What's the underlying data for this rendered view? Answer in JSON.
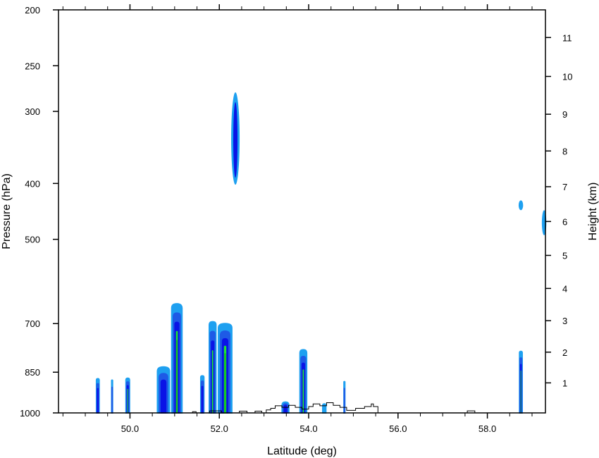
{
  "chart_data": {
    "type": "contour-cross-section",
    "xlabel": "Latitude (deg)",
    "ylabel_left": "Pressure (hPa)",
    "ylabel_right": "Height (km)",
    "xlim": [
      48.4,
      59.3
    ],
    "x_ticks": [
      50.0,
      52.0,
      54.0,
      56.0,
      58.0
    ],
    "x_tick_labels": [
      "50.0",
      "52.0",
      "54.0",
      "56.0",
      "58.0"
    ],
    "x_minor_ticks": [
      48.5,
      49.0,
      49.5,
      50.5,
      51.0,
      51.5,
      52.5,
      53.0,
      53.5,
      54.5,
      55.0,
      55.5,
      56.5,
      57.0,
      57.5,
      58.5,
      59.0
    ],
    "ylim_pressure": [
      1000,
      200
    ],
    "pressure_scale": "log",
    "pressure_ticks": [
      200,
      250,
      300,
      400,
      500,
      700,
      850,
      1000
    ],
    "pressure_tick_labels": [
      "200",
      "250",
      "300",
      "400",
      "500",
      "700",
      "850",
      "1000"
    ],
    "height_ticks": [
      1,
      2,
      3,
      4,
      5,
      6,
      7,
      8,
      9,
      10,
      11
    ],
    "height_tick_labels": [
      "1",
      "2",
      "3",
      "4",
      "5",
      "6",
      "7",
      "8",
      "9",
      "10",
      "11"
    ],
    "colors": {
      "level1": "#1ea0f0",
      "level2": "#1e5ae6",
      "level3": "#0a14e6",
      "level4": "#1ee632",
      "level5": "#14c81e",
      "terrain": "#000000"
    },
    "cells": [
      {
        "lat": 49.28,
        "width": 0.09,
        "top": 870,
        "levels": 3
      },
      {
        "lat": 49.6,
        "width": 0.05,
        "top": 875,
        "levels": 2
      },
      {
        "lat": 49.95,
        "width": 0.11,
        "top": 868,
        "levels": 4
      },
      {
        "lat": 50.75,
        "width": 0.3,
        "top": 830,
        "levels": 3
      },
      {
        "lat": 51.05,
        "width": 0.26,
        "top": 645,
        "levels": 5
      },
      {
        "lat": 51.62,
        "width": 0.1,
        "top": 860,
        "levels": 3
      },
      {
        "lat": 51.85,
        "width": 0.18,
        "top": 693,
        "levels": 4
      },
      {
        "lat": 52.13,
        "width": 0.33,
        "top": 698,
        "levels": 5
      },
      {
        "lat": 53.48,
        "width": 0.18,
        "top": 955,
        "levels": 3
      },
      {
        "lat": 53.88,
        "width": 0.18,
        "top": 775,
        "levels": 4
      },
      {
        "lat": 54.35,
        "width": 0.1,
        "top": 962,
        "levels": 1
      },
      {
        "lat": 54.8,
        "width": 0.05,
        "top": 880,
        "levels": 2
      },
      {
        "lat": 58.75,
        "width": 0.09,
        "top": 780,
        "levels": 4
      }
    ],
    "upper_features": [
      {
        "lat": 52.36,
        "p_top": 278,
        "p_bottom": 402,
        "levels": 2
      },
      {
        "lat": 58.75,
        "p_top": 428,
        "p_bottom": 445,
        "levels": 1
      },
      {
        "lat": 59.27,
        "p_top": 445,
        "p_bottom": 492,
        "levels": 1
      }
    ],
    "terrain": [
      [
        48.4,
        1000
      ],
      [
        51.4,
        1000
      ],
      [
        51.4,
        995
      ],
      [
        51.48,
        995
      ],
      [
        51.48,
        1000
      ],
      [
        51.78,
        1000
      ],
      [
        51.78,
        992
      ],
      [
        52.05,
        992
      ],
      [
        52.05,
        1000
      ],
      [
        52.45,
        1000
      ],
      [
        52.45,
        993
      ],
      [
        52.62,
        993
      ],
      [
        52.62,
        1000
      ],
      [
        52.8,
        1000
      ],
      [
        52.8,
        993
      ],
      [
        52.95,
        993
      ],
      [
        52.95,
        1000
      ],
      [
        53.05,
        1000
      ],
      [
        53.05,
        988
      ],
      [
        53.15,
        988
      ],
      [
        53.15,
        982
      ],
      [
        53.25,
        982
      ],
      [
        53.25,
        972
      ],
      [
        53.4,
        972
      ],
      [
        53.4,
        978
      ],
      [
        53.55,
        978
      ],
      [
        53.55,
        970
      ],
      [
        53.7,
        970
      ],
      [
        53.7,
        978
      ],
      [
        53.85,
        978
      ],
      [
        53.85,
        985
      ],
      [
        54.0,
        985
      ],
      [
        54.0,
        975
      ],
      [
        54.1,
        975
      ],
      [
        54.1,
        965
      ],
      [
        54.25,
        965
      ],
      [
        54.25,
        972
      ],
      [
        54.4,
        972
      ],
      [
        54.4,
        960
      ],
      [
        54.55,
        960
      ],
      [
        54.55,
        970
      ],
      [
        54.7,
        970
      ],
      [
        54.7,
        978
      ],
      [
        54.85,
        978
      ],
      [
        54.85,
        990
      ],
      [
        55.05,
        990
      ],
      [
        55.05,
        982
      ],
      [
        55.25,
        982
      ],
      [
        55.25,
        975
      ],
      [
        55.4,
        975
      ],
      [
        55.4,
        965
      ],
      [
        55.45,
        965
      ],
      [
        55.45,
        975
      ],
      [
        55.55,
        975
      ],
      [
        55.55,
        1000
      ],
      [
        57.55,
        1000
      ],
      [
        57.55,
        992
      ],
      [
        57.72,
        992
      ],
      [
        57.72,
        1000
      ],
      [
        59.3,
        1000
      ]
    ]
  }
}
